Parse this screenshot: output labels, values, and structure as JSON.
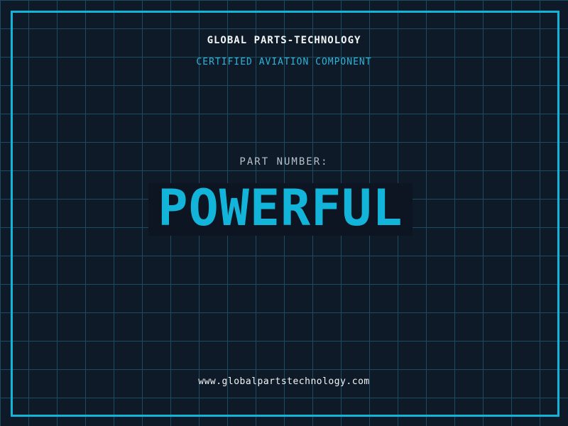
{
  "header": {
    "company_name": "GLOBAL PARTS-TECHNOLOGY",
    "certification_line": "CERTIFIED AVIATION COMPONENT"
  },
  "main": {
    "part_label": "PART NUMBER:",
    "part_number": "POWERFUL"
  },
  "footer": {
    "website": "www.globalpartstechnology.com"
  },
  "colors": {
    "background": "#0f1a29",
    "panel": "#0d1522",
    "grid_line": "#1c4c60",
    "accent": "#12b5d9",
    "accent_light": "#2cb4d8",
    "label_gray": "#b6c1c9",
    "text_white": "#f2f5f6"
  }
}
